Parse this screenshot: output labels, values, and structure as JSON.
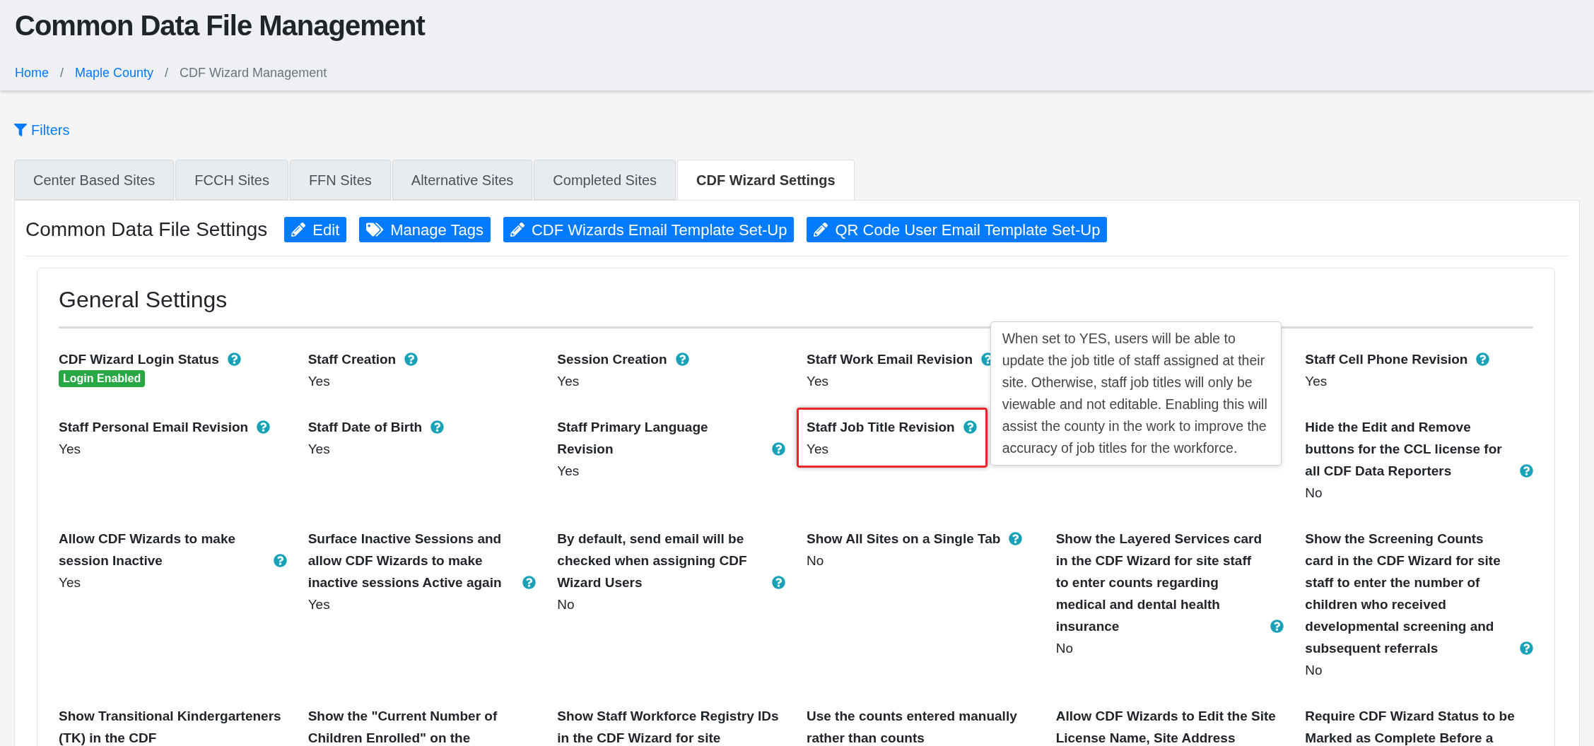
{
  "header": {
    "title": "Common Data File Management",
    "breadcrumb": [
      {
        "kind": "link",
        "label": "Home"
      },
      {
        "kind": "separator",
        "label": "/"
      },
      {
        "kind": "link",
        "label": "Maple County"
      },
      {
        "kind": "separator",
        "label": "/"
      },
      {
        "kind": "current",
        "label": "CDF Wizard Management"
      }
    ]
  },
  "filters": {
    "label": "Filters"
  },
  "tabs": [
    {
      "label": "Center Based Sites",
      "selected": false
    },
    {
      "label": "FCCH Sites",
      "selected": false
    },
    {
      "label": "FFN Sites",
      "selected": false
    },
    {
      "label": "Alternative Sites",
      "selected": false
    },
    {
      "label": "Completed Sites",
      "selected": false
    },
    {
      "label": "CDF Wizard Settings",
      "selected": true
    }
  ],
  "settings_header": {
    "title": "Common Data File Settings",
    "buttons": [
      "Edit",
      "Manage Tags",
      "CDF Wizards Email Template Set-Up",
      "QR Code User Email Template Set-Up"
    ]
  },
  "general_settings": {
    "title": "General Settings",
    "items": [
      {
        "kind": "setting",
        "label": "CDF Wizard Login Status",
        "help": true,
        "badge": "Login Enabled",
        "highlighted": false
      },
      {
        "kind": "setting",
        "label": "Staff Creation",
        "help": true,
        "value": "Yes",
        "highlighted": false
      },
      {
        "kind": "setting",
        "label": "Session Creation",
        "help": true,
        "value": "Yes",
        "highlighted": false
      },
      {
        "kind": "setting",
        "label": "Staff Work Email Revision",
        "help": true,
        "value": "Yes",
        "highlighted": false
      },
      {
        "kind": "tooltip",
        "text": "When set to YES, users will be able to update the job title of staff assigned at their site. Otherwise, staff job titles will only be viewable and not editable. Enabling this will assist the county in the work to improve the accuracy of job titles for the workforce."
      },
      {
        "kind": "setting",
        "label": "Staff Cell Phone Revision",
        "help": true,
        "value": "Yes",
        "highlighted": false
      },
      {
        "kind": "setting",
        "label": "Staff Personal Email Revision",
        "help": true,
        "value": "Yes",
        "highlighted": false
      },
      {
        "kind": "setting",
        "label": "Staff Date of Birth",
        "help": true,
        "value": "Yes",
        "highlighted": false
      },
      {
        "kind": "setting",
        "label": "Staff Primary Language Revision",
        "help": true,
        "value": "Yes",
        "highlighted": false
      },
      {
        "kind": "setting",
        "label": "Staff Job Title Revision",
        "help": true,
        "value": "Yes",
        "highlighted": true
      },
      {
        "kind": "setting",
        "label": "Hide the Edit and Remove buttons for the CCL license for all CDF Data Reporters",
        "help": true,
        "value": "No",
        "highlighted": false
      },
      {
        "kind": "setting",
        "label": "Allow CDF Wizards to make session Inactive",
        "help": true,
        "value": "Yes",
        "highlighted": false
      },
      {
        "kind": "setting",
        "label": "Surface Inactive Sessions and allow CDF Wizards to make inactive sessions Active again",
        "help": true,
        "value": "Yes",
        "highlighted": false
      },
      {
        "kind": "setting",
        "label": "By default, send email will be checked when assigning CDF Wizard Users",
        "help": true,
        "value": "No",
        "highlighted": false
      },
      {
        "kind": "setting",
        "label": "Show All Sites on a Single Tab",
        "help": true,
        "value": "No",
        "highlighted": false
      },
      {
        "kind": "setting",
        "label": "Show the Layered Services card in the CDF Wizard for site staff to enter counts regarding medical and dental health insurance",
        "help": true,
        "value": "No",
        "highlighted": false
      },
      {
        "kind": "setting",
        "label": "Show the Screening Counts card in the CDF Wizard for site staff to enter the number of children who received developmental screening and subsequent referrals",
        "help": true,
        "value": "No",
        "highlighted": false
      },
      {
        "kind": "setting",
        "label": "Show Transitional Kindergarteners (TK) in the CDF",
        "help": false,
        "highlighted": false
      },
      {
        "kind": "setting",
        "label": "Show the \"Current Number of Children Enrolled\" on the",
        "help": false,
        "highlighted": false
      },
      {
        "kind": "setting",
        "label": "Show Staff Workforce Registry IDs in the CDF Wizard for site",
        "help": false,
        "highlighted": false
      },
      {
        "kind": "setting",
        "label": "Use the counts entered manually rather than counts",
        "help": false,
        "highlighted": false
      },
      {
        "kind": "setting",
        "label": "Allow CDF Wizards to Edit the Site License Name, Site Address",
        "help": false,
        "highlighted": false
      },
      {
        "kind": "setting",
        "label": "Require CDF Wizard Status to be Marked as Complete Before a",
        "help": false,
        "highlighted": false
      }
    ]
  }
}
